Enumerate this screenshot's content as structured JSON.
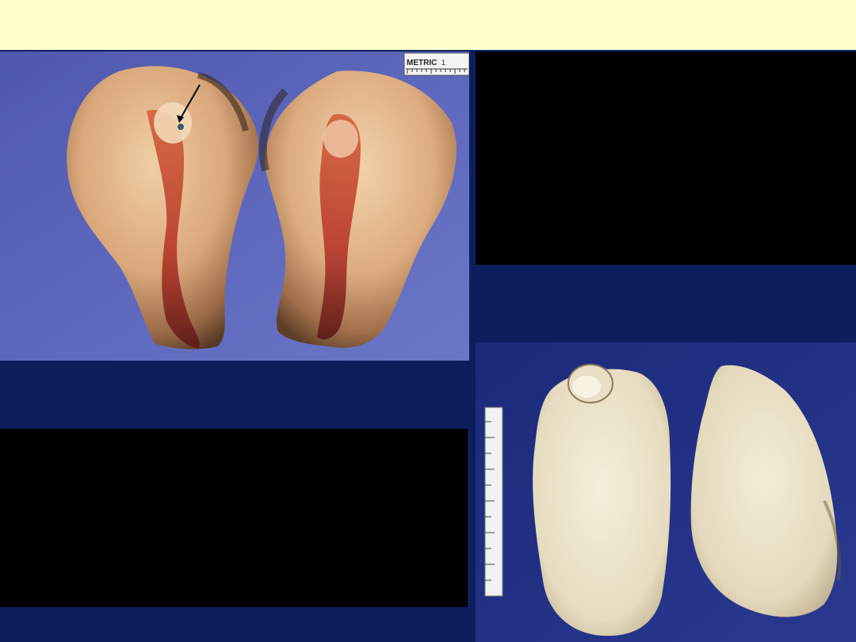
{
  "top_band": {
    "color": "#ffffcc"
  },
  "background": {
    "color": "#0c1f5c"
  },
  "photos": {
    "uterus": {
      "description_icon": "uterus-cross-section-photo",
      "ruler_label": "METRIC",
      "ruler_digit": "1",
      "backdrop_color": "#5a64b8"
    },
    "fibroid": {
      "description_icon": "fibroid-cross-section-photo",
      "backdrop_color": "#1f2b78"
    }
  },
  "black_boxes": {
    "color": "#000000"
  }
}
